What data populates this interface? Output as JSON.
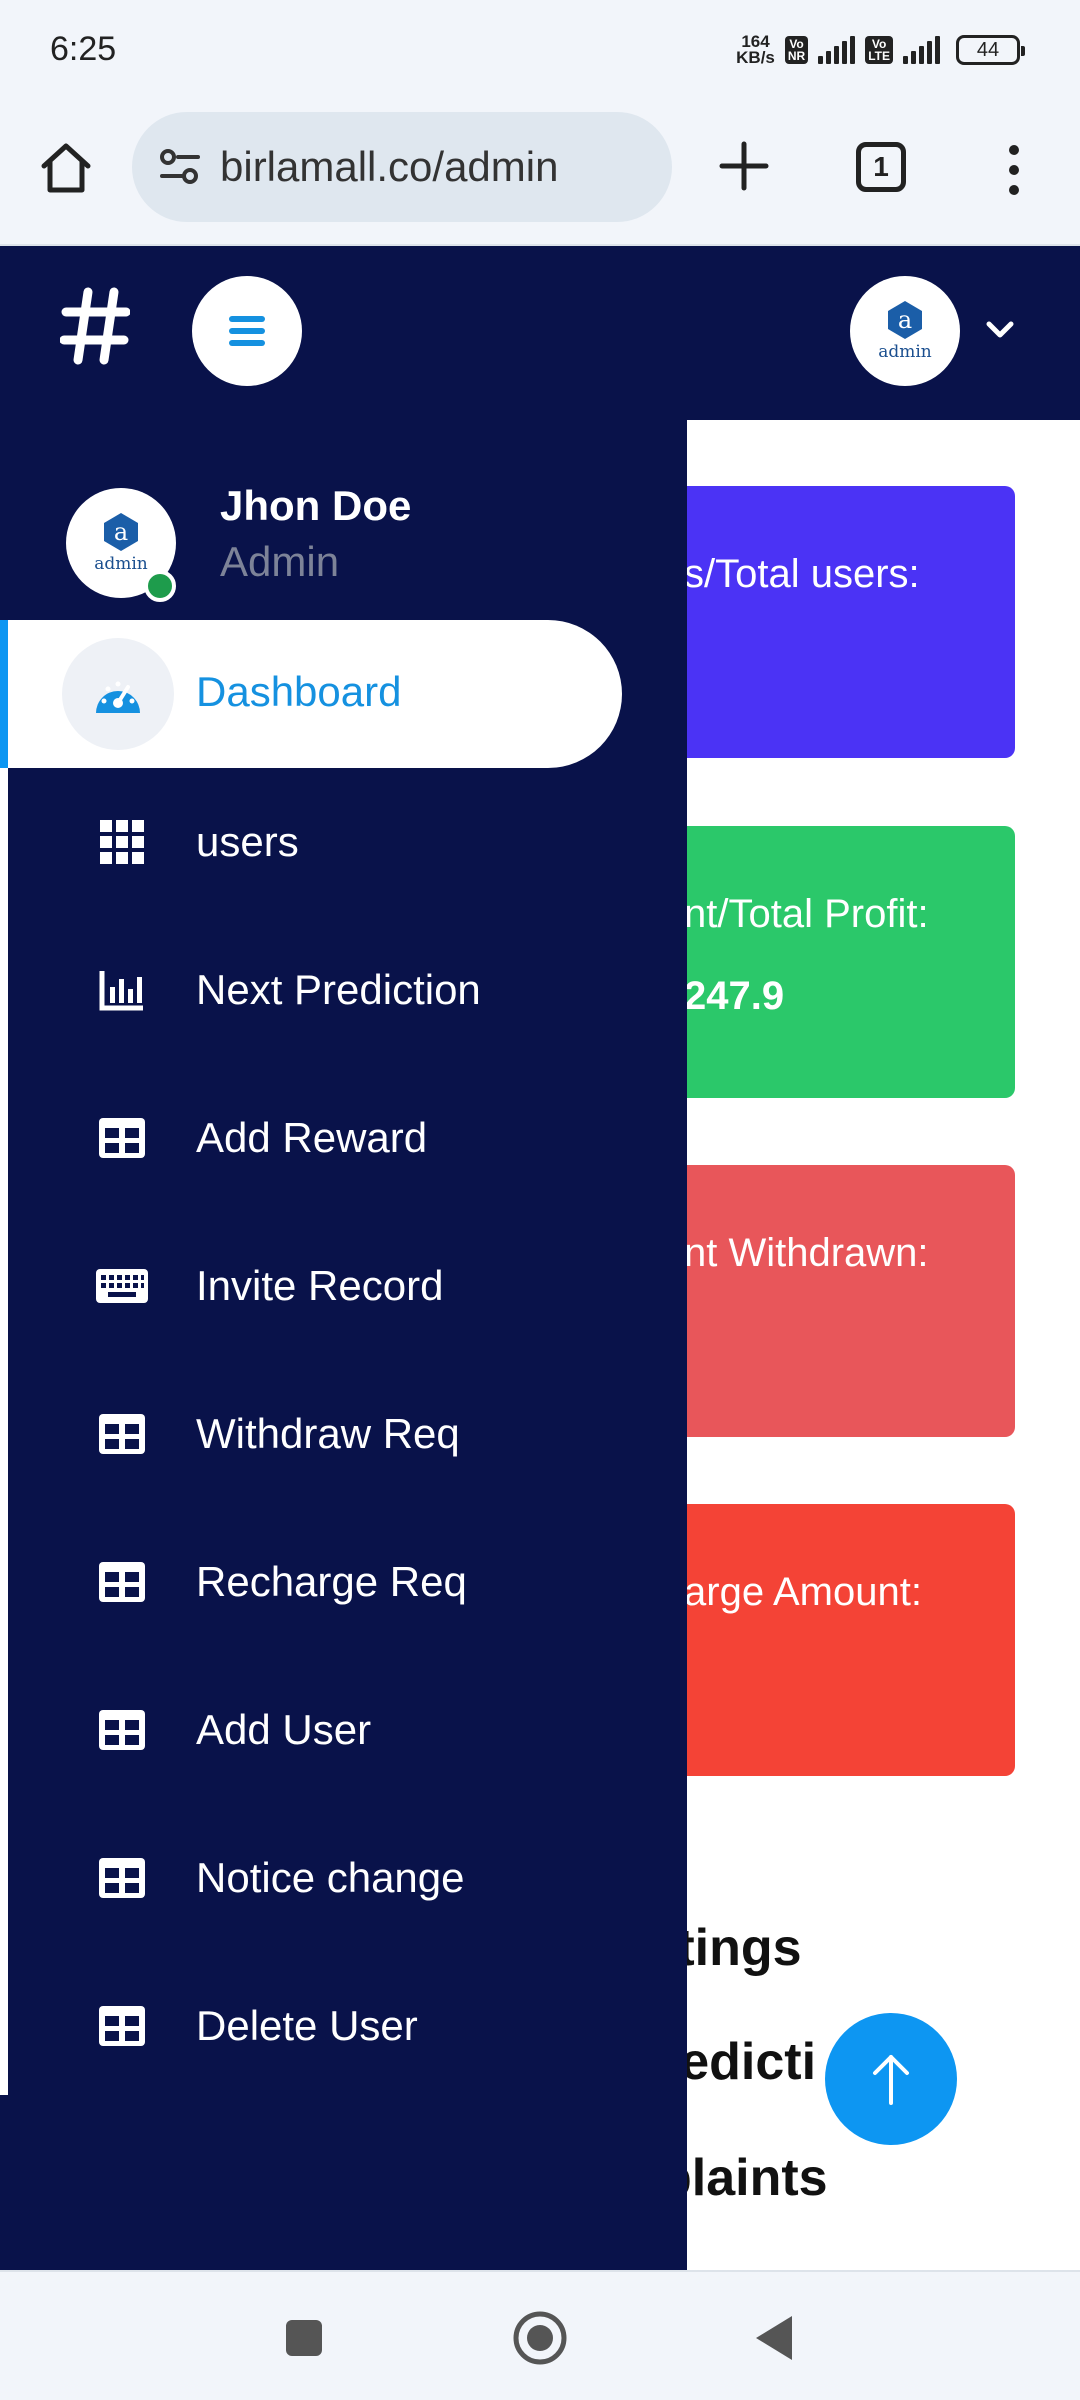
{
  "status_bar": {
    "time": "6:25",
    "net_speed_value": "164",
    "net_speed_unit": "KB/s",
    "volte_1_top": "Vo",
    "volte_1_bottom": "NR",
    "volte_2_top": "Vo",
    "volte_2_bottom": "LTE",
    "battery": "44"
  },
  "browser": {
    "url": "birlamall.co/admin",
    "tab_count": "1"
  },
  "header": {
    "avatar_label": "admin"
  },
  "profile": {
    "avatar_label": "admin",
    "name": "Jhon Doe",
    "role": "Admin"
  },
  "sidebar": {
    "items": [
      {
        "label": "Dashboard",
        "icon": "dashboard-gauge-icon"
      },
      {
        "label": "users",
        "icon": "grid-icon"
      },
      {
        "label": "Next Prediction",
        "icon": "bar-chart-icon"
      },
      {
        "label": "Add Reward",
        "icon": "table-icon"
      },
      {
        "label": "Invite Record",
        "icon": "keyboard-icon"
      },
      {
        "label": "Withdraw Req",
        "icon": "table-icon"
      },
      {
        "label": "Recharge Req",
        "icon": "table-icon"
      },
      {
        "label": "Add User",
        "icon": "table-icon"
      },
      {
        "label": "Notice change",
        "icon": "table-icon"
      },
      {
        "label": "Delete User",
        "icon": "table-icon"
      }
    ]
  },
  "cards": [
    {
      "label": "s/Total users:",
      "value": "",
      "color": "#4b33f5"
    },
    {
      "label": "nt/Total Profit:",
      "value": "247.9",
      "color": "#2bc86a"
    },
    {
      "label": "nt Withdrawn:",
      "value": "",
      "color": "#e8565a"
    },
    {
      "label": "arge Amount:",
      "value": "",
      "color": "#f44336"
    }
  ],
  "links": {
    "settings": "ttings",
    "prediction": "redicti",
    "complaints": "plaints"
  },
  "colors": {
    "navy": "#09124a",
    "accent_blue": "#0d96f2",
    "online_green": "#1e9c4c"
  }
}
